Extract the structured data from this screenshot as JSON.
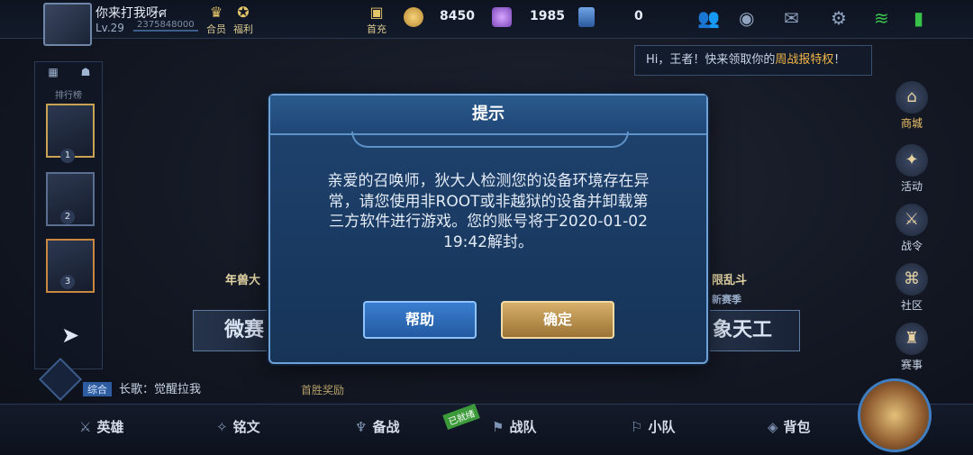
{
  "player": {
    "name": "你来打我呀ศ",
    "level": "Lv.29",
    "id": "2375848000"
  },
  "top_icons": [
    {
      "label": "合员"
    },
    {
      "label": "福利"
    },
    {
      "label": "首充"
    }
  ],
  "currencies": {
    "gold": "8450",
    "gems": "1985",
    "cards": "0"
  },
  "tooltip": {
    "text": "Hi，王者！快来领取你的",
    "highlight": "周战报特权",
    "suffix": "！"
  },
  "left_panel": {
    "tab_label": "排行榜",
    "ranks": [
      "1",
      "2",
      "3"
    ]
  },
  "right_menu": [
    "商城",
    "活动",
    "战令",
    "社区",
    "赛事"
  ],
  "background": {
    "mode_left": "微赛",
    "mode_right": "象天工",
    "banner_left": "年兽大",
    "banner_right": "限乱斗",
    "season_tag": "新赛季"
  },
  "chat": {
    "channel": "综合",
    "message": "长歌：觉醒拉我"
  },
  "first_win": "首胜奖励",
  "bottom_nav": [
    "英雄",
    "铭文",
    "备战",
    "战队",
    "小队",
    "背包"
  ],
  "battle_tag": "已就绪",
  "dialog": {
    "title": "提示",
    "message_line1": "亲爱的召唤师，狄大人检测您的设备环境存在异",
    "message_line2": "常，请您使用非ROOT或非越狱的设备并卸载第",
    "message_line3": "三方软件进行游戏。您的账号将于2020-01-02",
    "message_line4": "19:42解封。",
    "help_label": "帮助",
    "ok_label": "确定"
  },
  "colors": {
    "dialog_bg": "#1a3a62",
    "help_btn": "#2f6bb8",
    "ok_btn": "#c39a55",
    "highlight": "#f0b54a"
  }
}
